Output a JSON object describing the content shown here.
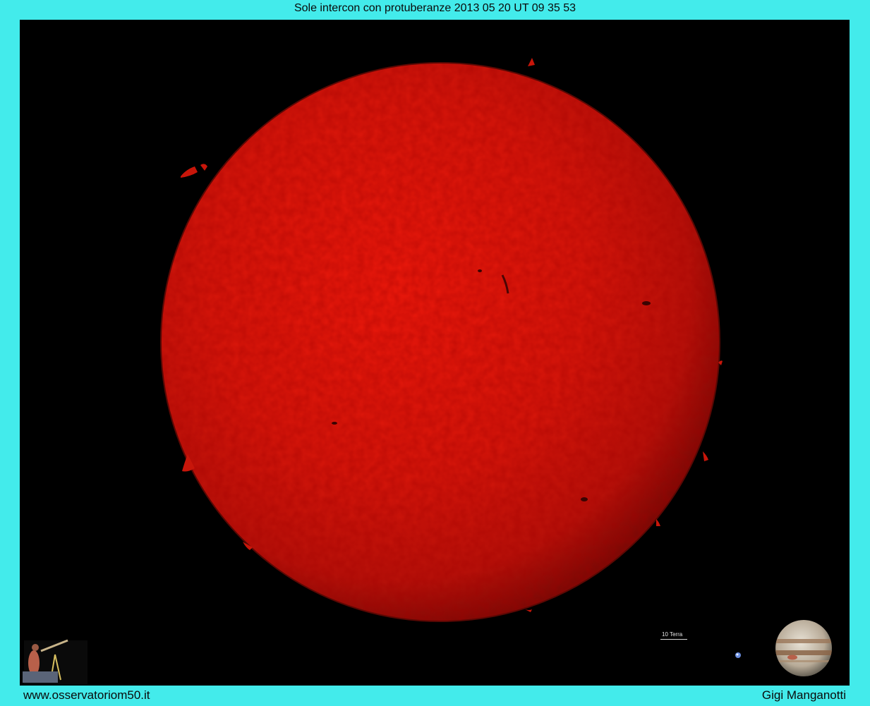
{
  "title": "Sole intercon con protuberanze 2013 05 20 UT 09 35 53",
  "footer": {
    "website": "www.osservatoriom50.it",
    "author": "Gigi Manganotti"
  },
  "scale": {
    "label": "10 Terra"
  },
  "colors": {
    "background": "#43ebeb",
    "frame": "#000000",
    "sun": "#d0180c"
  },
  "icons": [
    "observer-logo-icon",
    "earth-icon",
    "jupiter-icon"
  ]
}
